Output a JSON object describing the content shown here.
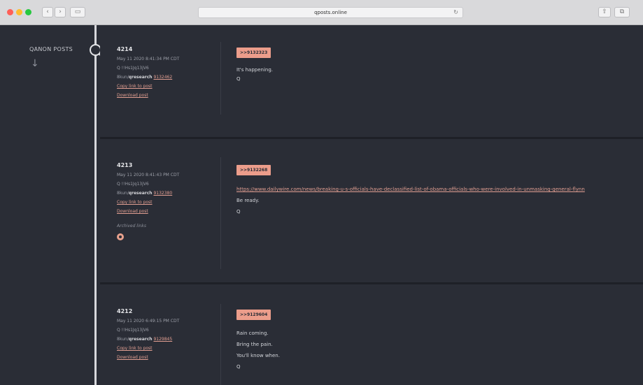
{
  "browser": {
    "url": "qposts.online",
    "traffic_lights": [
      "#ff5f57",
      "#ffbd2e",
      "#28c840"
    ]
  },
  "sidebar": {
    "title": "QANON POSTS",
    "arrow": "↓"
  },
  "posts": [
    {
      "id": "4214",
      "date": "May 11 2020 8:41:34 PM CDT",
      "author": "Q !!Hs1Jq13jV6",
      "board_label": "8kun/",
      "board_name": "qresearch",
      "board_ref": "9132462",
      "copy_link": "Copy link to post",
      "download": "Download post",
      "reply_tag": ">>9132323",
      "lines": [
        "It's happening.",
        "Q"
      ]
    },
    {
      "id": "4213",
      "date": "May 11 2020 8:41:43 PM CDT",
      "author": "Q !!Hs1Jq13jV6",
      "board_label": "8kun/",
      "board_name": "qresearch",
      "board_ref": "9132380",
      "copy_link": "Copy link to post",
      "download": "Download post",
      "archived_label": "Archived links",
      "reply_tag": ">>9132268",
      "link": "https://www.dailywire.com/news/breaking-u-s-officials-have-declassified-list-of-obama-officials-who-were-involved-in-unmasking-general-flynn",
      "lines": [
        "Be ready.",
        "Q"
      ]
    },
    {
      "id": "4212",
      "date": "May 11 2020 6:49:15 PM CDT",
      "author": "Q !!Hs1Jq13jV6",
      "board_label": "8kun/",
      "board_name": "qresearch",
      "board_ref": "9129845",
      "copy_link": "Copy link to post",
      "download": "Download post",
      "reply_tag": ">>9129604",
      "lines": [
        "Rain coming.",
        "Bring the pain.",
        "You'll know when.",
        "Q"
      ]
    }
  ]
}
